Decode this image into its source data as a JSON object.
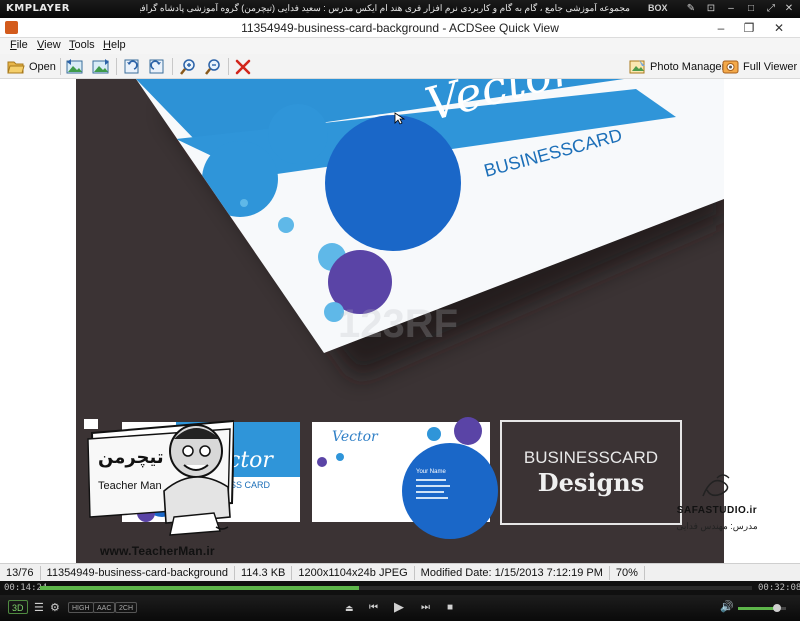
{
  "kmplayer": {
    "logo": "KMPLAYER",
    "title": "مجموعه آموزشی جامع ، گام به گام و کاربردی نرم افزار فری هند ام ایکس  مدرس : سعید فدایی (تیچرمن) گروه آموزشی پادشاه گرافیست ها",
    "box_label": "BOX",
    "time_current": "00:14:24",
    "time_total": "00:32:08",
    "progress": 0.448,
    "badges": [
      "3D",
      "HIGH",
      "AAC",
      "2CH"
    ],
    "volume": 0.82,
    "colors": {
      "accent": "#5db54a"
    }
  },
  "acdsee": {
    "title": "11354949-business-card-background - ACDSee Quick View",
    "menu": [
      "File",
      "View",
      "Tools",
      "Help"
    ],
    "toolbar": {
      "open_label": "Open",
      "photo_manager_label": "Photo Manager",
      "full_viewer_label": "Full Viewer"
    },
    "status": {
      "index": "13/76",
      "filename": "11354949-business-card-background",
      "size": "114.3 KB",
      "dimensions": "1200x1104x24b JPEG",
      "modified": "Modified Date: 1/15/2013 7:12:19 PM",
      "zoom": "70%"
    }
  },
  "image": {
    "card_heading": "Vector",
    "card_title": "BUSINESSCARD",
    "thumb2_heading": "Vector",
    "thumb2_name": "Your Name",
    "thumb3_line1": "BUSINESSCARD",
    "thumb3_line2": "Designs",
    "watermark": "123RF"
  },
  "overlays": {
    "teacher_logo_text": "تیچرمن",
    "teacher_name": "Teacher Man",
    "teacher_url": "www.TeacherMan.ir",
    "safa_url": "SAFASTUDIO.ir",
    "safa_teacher": "مدرس: مهندس فدایی"
  }
}
